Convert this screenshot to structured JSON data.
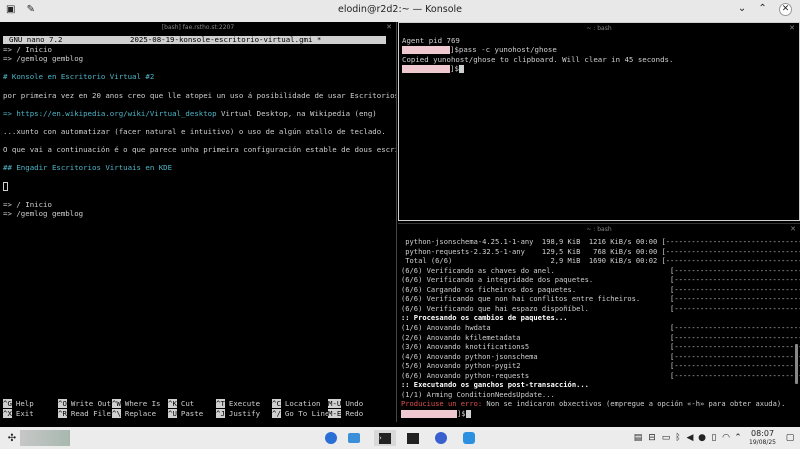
{
  "window": {
    "title": "elodin@r2d2:~ — Konsole"
  },
  "pane_left": {
    "title": "[bash] fae.rstho.st:2207",
    "nano": {
      "version": "GNU nano 7.2",
      "filename": "2025-08-19-konsole-escritorio-virtual.gmi *",
      "lines": [
        {
          "text": "=> / Inicio",
          "style": "plain"
        },
        {
          "text": "=> /gemlog gemblog",
          "style": "plain"
        },
        {
          "text": "",
          "style": "plain"
        },
        {
          "text": "# Konsole en Escritorio Virtual #2",
          "style": "cyan"
        },
        {
          "text": "",
          "style": "plain"
        },
        {
          "text": "por primeira vez en 20 anos creo que lle atopei un uso á posibilidade de usar Escritorios Virtuais.",
          "style": "plain"
        },
        {
          "text": "",
          "style": "plain"
        },
        {
          "text": "=> https://en.wikipedia.org/wiki/Virtual_desktop",
          "style": "link",
          "suffix": " Virtual Desktop, na Wikipedia (eng)"
        },
        {
          "text": "",
          "style": "plain"
        },
        {
          "text": "...xunto con automatizar (facer natural e intuitivo) o uso de algún atallo de teclado.",
          "style": "plain"
        },
        {
          "text": "",
          "style": "plain"
        },
        {
          "text": "O que vai a continuación é o que parece unha primeira configuración estable de dous escritorios virt",
          "style": "plain",
          "cursor_after": true
        },
        {
          "text": "",
          "style": "plain"
        },
        {
          "text": "## Engadir Escritorios Virtuais en KDE",
          "style": "cyan"
        },
        {
          "text": "",
          "style": "plain"
        },
        {
          "text": "",
          "style": "plain",
          "cursor_only": true
        },
        {
          "text": "",
          "style": "plain"
        },
        {
          "text": "=> / Inicio",
          "style": "plain"
        },
        {
          "text": "=> /gemlog gemblog",
          "style": "plain"
        }
      ],
      "shortcuts_row1": [
        {
          "key": "^G",
          "label": "Help"
        },
        {
          "key": "^O",
          "label": "Write Out"
        },
        {
          "key": "^W",
          "label": "Where Is"
        },
        {
          "key": "^K",
          "label": "Cut"
        },
        {
          "key": "^T",
          "label": "Execute"
        },
        {
          "key": "^C",
          "label": "Location"
        },
        {
          "key": "M-U",
          "label": "Undo"
        }
      ],
      "shortcuts_row2": [
        {
          "key": "^X",
          "label": "Exit"
        },
        {
          "key": "^R",
          "label": "Read File"
        },
        {
          "key": "^\\",
          "label": "Replace"
        },
        {
          "key": "^U",
          "label": "Paste"
        },
        {
          "key": "^J",
          "label": "Justify"
        },
        {
          "key": "^/",
          "label": "Go To Line"
        },
        {
          "key": "M-E",
          "label": "Redo"
        }
      ]
    }
  },
  "pane_right_top": {
    "title": "~ : bash",
    "lines": [
      {
        "text": "Agent pid 769"
      },
      {
        "prompt": "]$",
        "text": "pass -c yunohost/ghose"
      },
      {
        "text": "Copied yunohost/ghose to clipboard. Will clear in 45 seconds."
      },
      {
        "prompt": "]$",
        "text": "",
        "cursor": true
      }
    ]
  },
  "pane_right_bottom": {
    "title": "~ : bash",
    "lines": [
      {
        "text": " python-jsonschema-4.25.1-1-any  198,9 KiB  1216 KiB/s 00:00 [--------------------------------] 100%",
        "style": "plain"
      },
      {
        "text": " python-requests-2.32.5-1-any    129,5 KiB   768 KiB/s 00:00 [--------------------------------] 100%",
        "style": "plain"
      },
      {
        "text": " Total (6/6)                       2,9 MiB  1690 KiB/s 00:02 [--------------------------------] 100%",
        "style": "plain"
      },
      {
        "text": "(6/6) Verificando as chaves do anel.                           [--------------------------------] 100%",
        "style": "plain"
      },
      {
        "text": "(6/6) Verificando a integridade dos paquetes.                  [--------------------------------] 100%",
        "style": "plain"
      },
      {
        "text": "(6/6) Cargando os ficheiros dos paquetes.                      [--------------------------------] 100%",
        "style": "plain"
      },
      {
        "text": "(6/6) Verificando que non hai conflitos entre ficheiros.       [--------------------------------] 100%",
        "style": "plain"
      },
      {
        "text": "(6/6) Verificando que hai espazo dispoñíbel.                   [--------------------------------] 100%",
        "style": "plain"
      },
      {
        "text": ":: Procesando os cambios de paquetes...",
        "style": "bold"
      },
      {
        "text": "(1/6) Anovando hwdata                                          [--------------------------------] 100%",
        "style": "plain"
      },
      {
        "text": "(2/6) Anovando kfilemetadata                                   [--------------------------------] 100%",
        "style": "plain"
      },
      {
        "text": "(3/6) Anovando knotifications5                                 [--------------------------------] 100%",
        "style": "plain"
      },
      {
        "text": "(4/6) Anovando python-jsonschema                               [--------------------------------] 100%",
        "style": "plain"
      },
      {
        "text": "(5/6) Anovando python-pygit2                                   [--------------------------------] 100%",
        "style": "plain"
      },
      {
        "text": "(6/6) Anovando python-requests                                 [--------------------------------] 100%",
        "style": "plain"
      },
      {
        "text": ":: Executando os ganchos post-transacción...",
        "style": "bold"
      },
      {
        "text": "(1/1) Arming ConditionNeedsUpdate...",
        "style": "plain"
      },
      {
        "text": "Produciuse un erro:",
        "style": "red",
        "suffix": " Non se indicaron obxectivos (empregue a opción «-h» para obter axuda)."
      },
      {
        "prompt": "]$",
        "text": "",
        "cursor": true,
        "style": "prompt"
      }
    ]
  },
  "taskbar": {
    "time": "08:07",
    "date": "19/08/25"
  }
}
